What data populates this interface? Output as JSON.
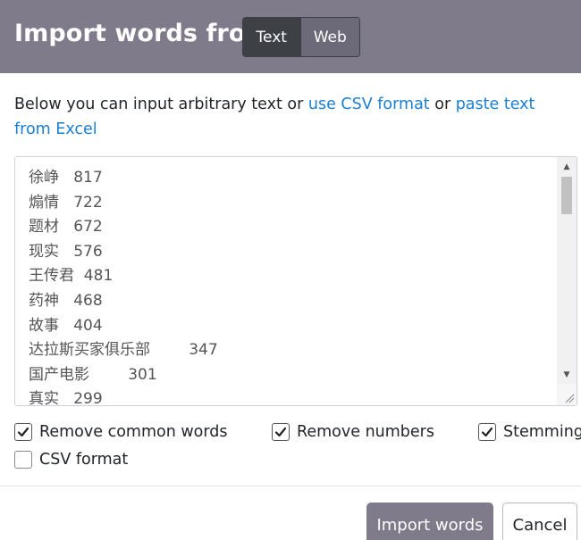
{
  "header": {
    "title": "Import words from",
    "tabs": [
      {
        "label": "Text",
        "active": true
      },
      {
        "label": "Web",
        "active": false
      }
    ],
    "background": "#7f7b8a"
  },
  "intro": {
    "text_before": "Below you can input arbitrary text or ",
    "link_csv": "use CSV format",
    "text_middle": " or ",
    "link_excel": "paste text from Excel"
  },
  "textarea": {
    "lines": [
      "徐峥   817",
      "煽情   722",
      "题材   672",
      "现实   576",
      "王传君  481",
      "药神   468",
      "故事   404",
      "达拉斯买家俱乐部        347",
      "国产电影        301",
      "真实   299"
    ]
  },
  "options": {
    "remove_common": {
      "label": "Remove common words",
      "checked": true
    },
    "remove_numbers": {
      "label": "Remove numbers",
      "checked": true
    },
    "stemming": {
      "label": "Stemming",
      "checked": true
    },
    "csv_format": {
      "label": "CSV format",
      "checked": false
    }
  },
  "footer": {
    "import_label": "Import words",
    "cancel_label": "Cancel"
  },
  "colors": {
    "accent": "#7f7b8a",
    "link": "#1a7fd3"
  }
}
